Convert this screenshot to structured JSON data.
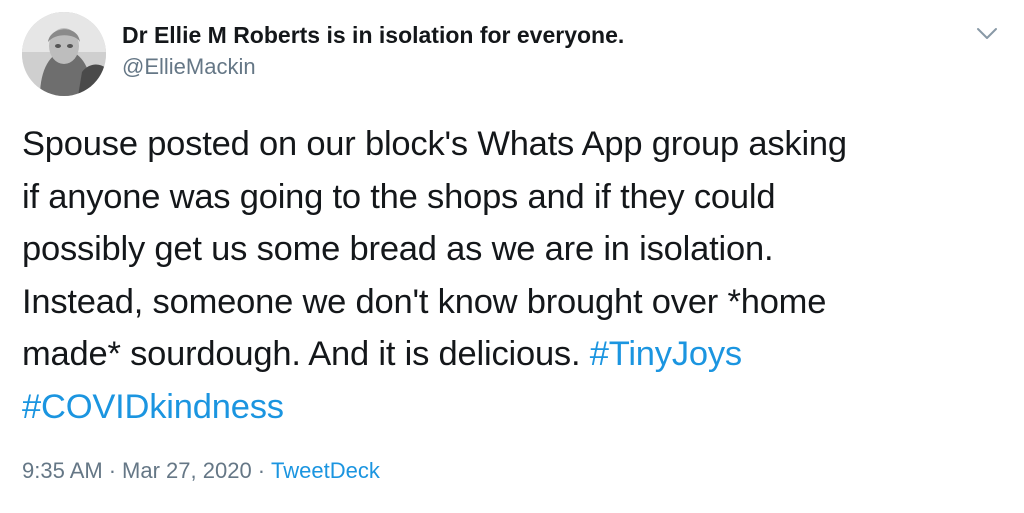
{
  "author": {
    "display_name": "Dr Ellie M Roberts is in isolation for everyone.",
    "handle": "@EllieMackin",
    "avatar_icon": "profile-photo"
  },
  "menu": {
    "icon": "chevron-down-icon"
  },
  "tweet": {
    "lines": [
      "Spouse posted on our block's Whats App group asking",
      "if anyone was going to the shops and if they could",
      "possibly get us some bread as we are in isolation.",
      "Instead, someone we don't know brought over *home"
    ],
    "line5_text": "made* sourdough. And it is delicious. ",
    "hashtag_1": "#TinyJoys",
    "hashtag_2": "#COVIDkindness"
  },
  "meta": {
    "time": "9:35 AM",
    "separator": "·",
    "date": "Mar 27, 2020",
    "source": "TweetDeck"
  },
  "colors": {
    "text": "#14171a",
    "secondary": "#657786",
    "link": "#1b95e0",
    "background": "#ffffff"
  }
}
